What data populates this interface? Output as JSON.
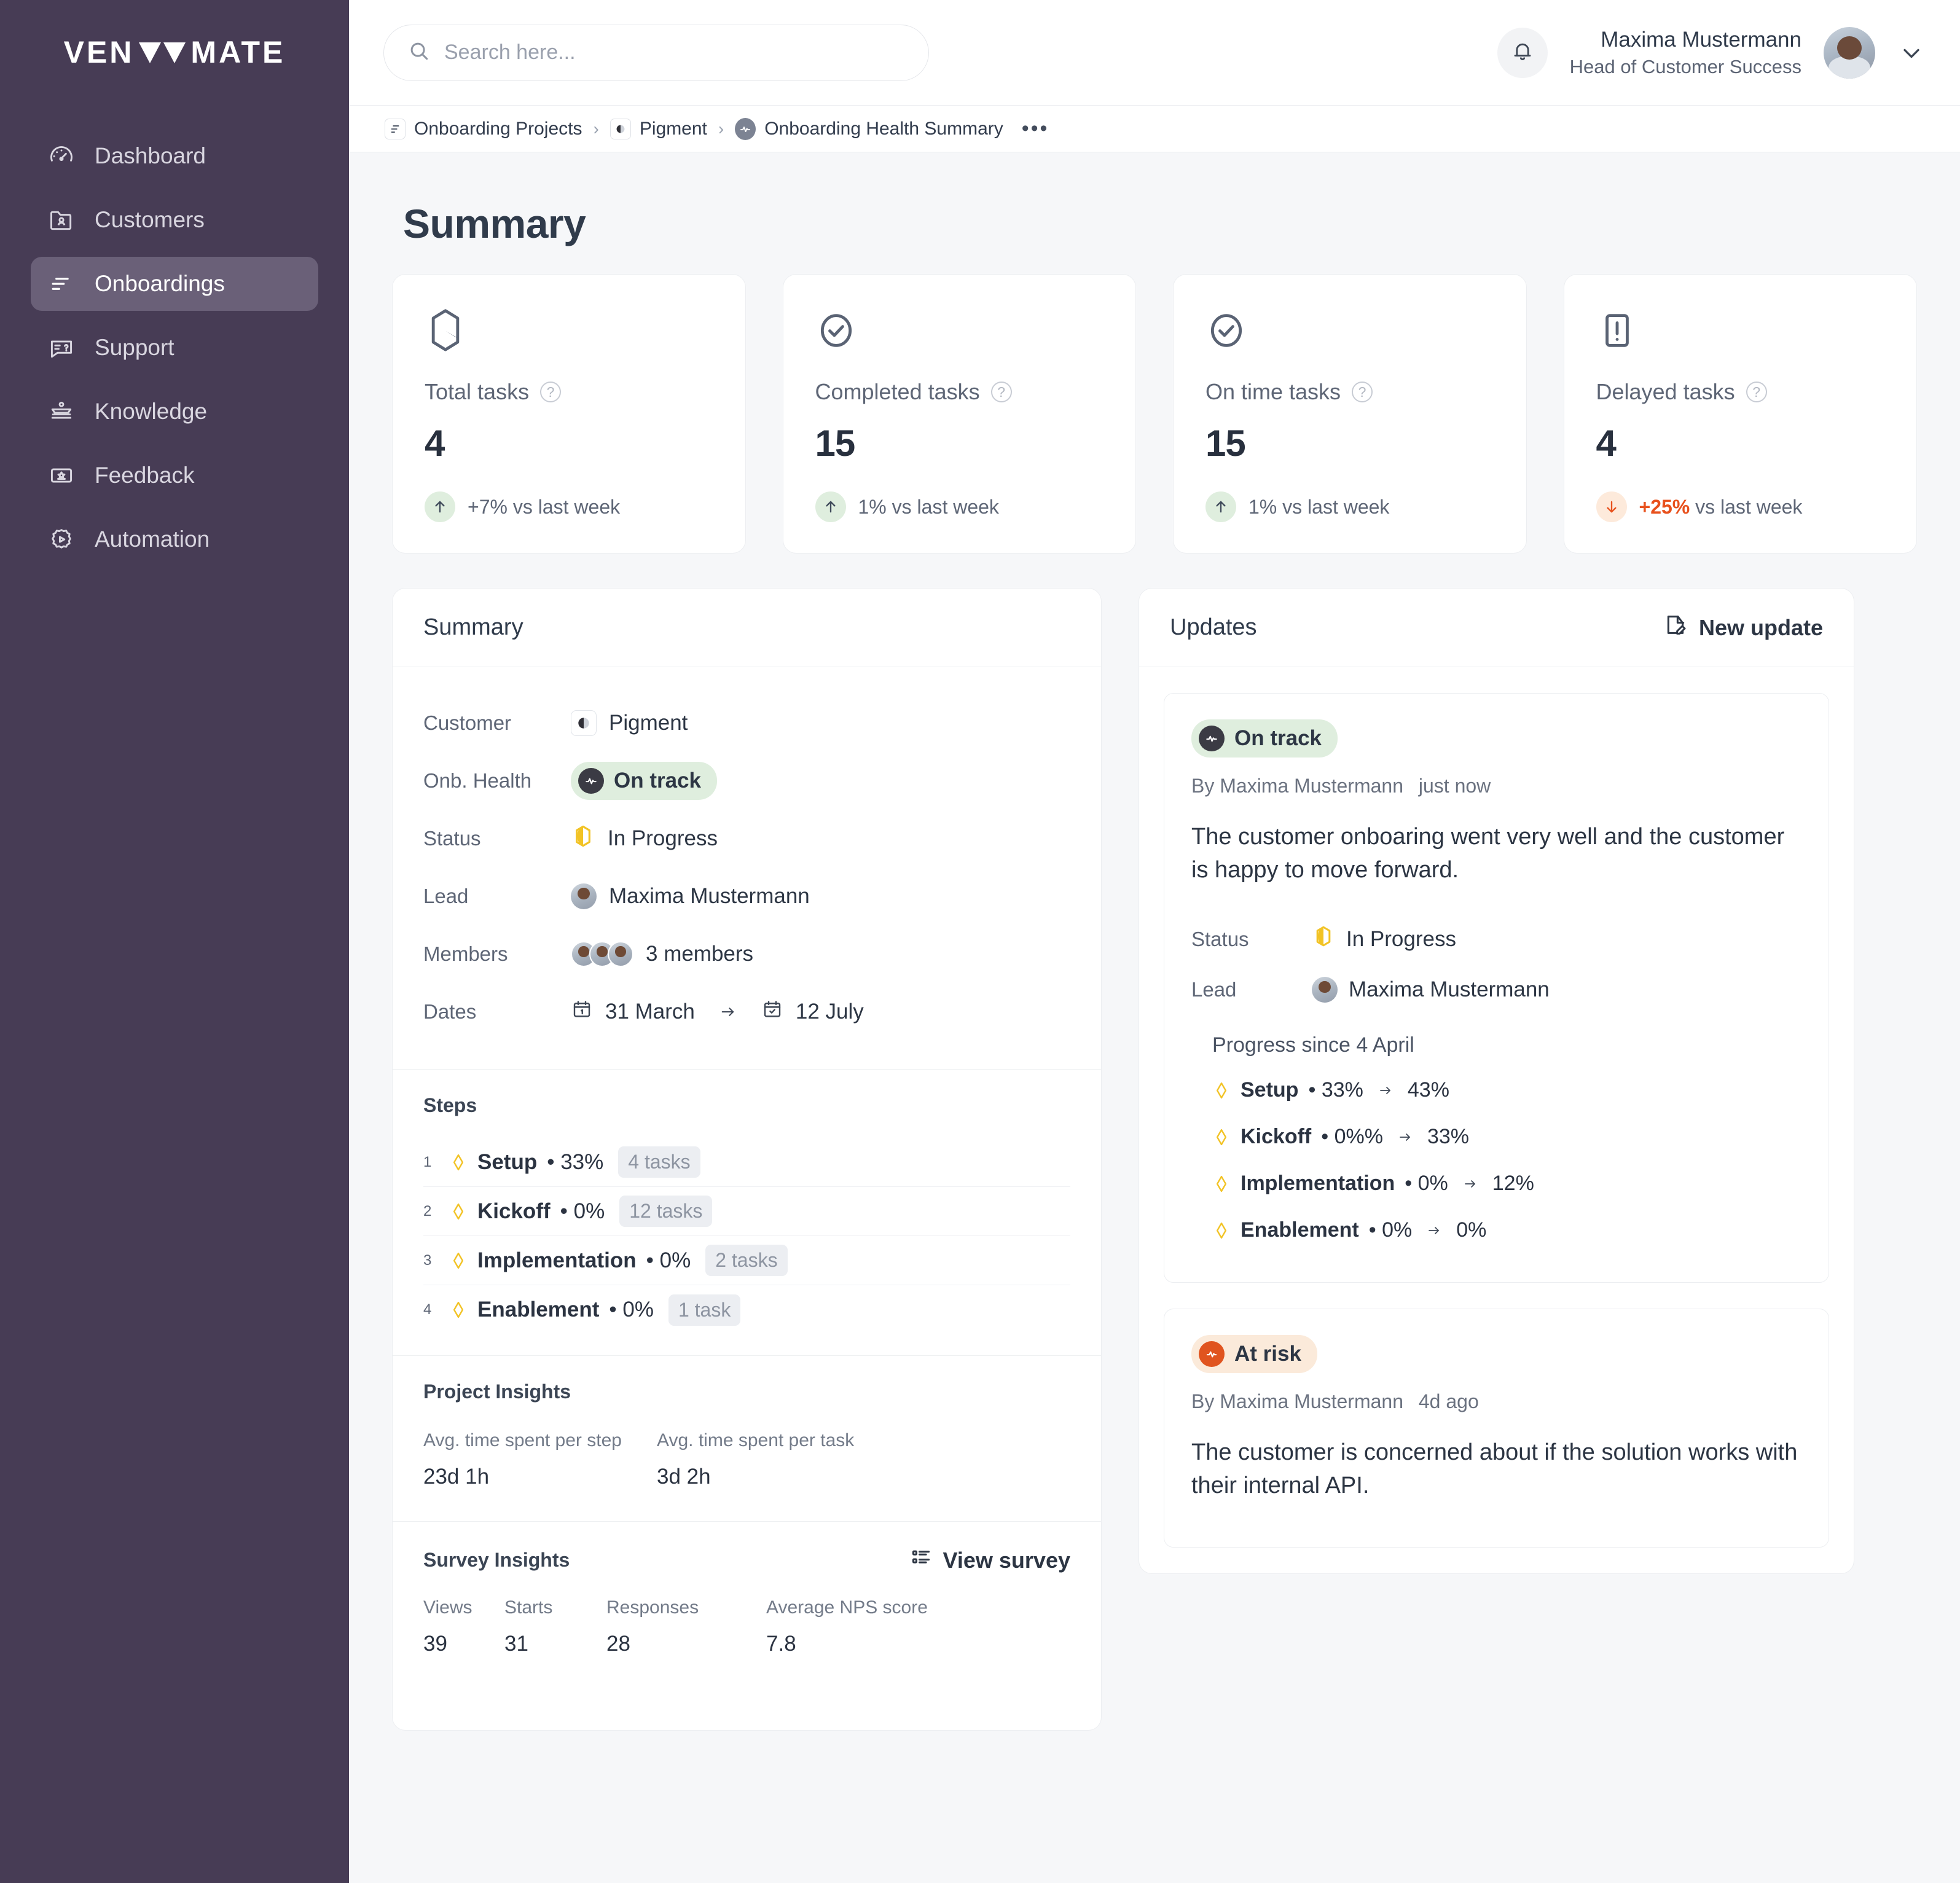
{
  "brand": {
    "name_left": "VEN",
    "name_right": "MATE",
    "sidebar_bg": "#473c55",
    "accent_green": "#dfeede",
    "accent_orange": "#e8511d"
  },
  "sidebar": {
    "items": [
      {
        "label": "Dashboard",
        "icon": "gauge-icon",
        "active": false
      },
      {
        "label": "Customers",
        "icon": "folder-user-icon",
        "active": false
      },
      {
        "label": "Onboardings",
        "icon": "onboarding-lines-icon",
        "active": true
      },
      {
        "label": "Support",
        "icon": "chat-question-icon",
        "active": false
      },
      {
        "label": "Knowledge",
        "icon": "books-icon",
        "active": false
      },
      {
        "label": "Feedback",
        "icon": "feedback-box-icon",
        "active": false
      },
      {
        "label": "Automation",
        "icon": "gear-play-icon",
        "active": false
      }
    ]
  },
  "topbar": {
    "search_placeholder": "Search here...",
    "user_name": "Maxima Mustermann",
    "user_role": "Head of Customer Success"
  },
  "breadcrumb": {
    "items": [
      {
        "label": "Onboarding Projects",
        "icon": "list-lines-icon"
      },
      {
        "label": "Pigment",
        "icon": "pigment-logo-icon"
      },
      {
        "label": "Onboarding Health Summary",
        "icon": "health-pulse-icon"
      }
    ],
    "overflow": "•••"
  },
  "page": {
    "title": "Summary"
  },
  "stats": [
    {
      "icon": "hexagon-half-icon",
      "label": "Total tasks",
      "value": "4",
      "delta": "+7%",
      "delta_suffix": "vs last week",
      "direction": "up",
      "highlight": false
    },
    {
      "icon": "check-circle-icon",
      "label": "Completed tasks",
      "value": "15",
      "delta": "1%",
      "delta_suffix": "vs last week",
      "direction": "up",
      "highlight": false
    },
    {
      "icon": "check-circle-icon",
      "label": "On time tasks",
      "value": "15",
      "delta": "1%",
      "delta_suffix": "vs last week",
      "direction": "up",
      "highlight": false
    },
    {
      "icon": "exclamation-box-icon",
      "label": "Delayed tasks",
      "value": "4",
      "delta": "+25%",
      "delta_suffix": "vs last week",
      "direction": "down",
      "highlight": true
    }
  ],
  "summary_panel": {
    "title": "Summary",
    "fields": [
      {
        "key": "Customer",
        "value": "Pigment",
        "kind": "logo"
      },
      {
        "key": "Onb. Health",
        "value": "On track",
        "kind": "badge-green"
      },
      {
        "key": "Status",
        "value": "In Progress",
        "kind": "status-diamond"
      },
      {
        "key": "Lead",
        "value": "Maxima Mustermann",
        "kind": "avatar"
      },
      {
        "key": "Members",
        "value": "3 members",
        "kind": "avatar-stack"
      },
      {
        "key": "Dates",
        "value": "",
        "kind": "dates",
        "date_start": "31 March",
        "date_end": "12 July"
      }
    ],
    "steps_title": "Steps",
    "steps": [
      {
        "num": "1",
        "name": "Setup",
        "pct": "33%",
        "tasks": "4 tasks"
      },
      {
        "num": "2",
        "name": "Kickoff",
        "pct": "0%",
        "tasks": "12 tasks"
      },
      {
        "num": "3",
        "name": "Implementation",
        "pct": "0%",
        "tasks": "2 tasks"
      },
      {
        "num": "4",
        "name": "Enablement",
        "pct": "0%",
        "tasks": "1 task"
      }
    ],
    "project_insights_title": "Project Insights",
    "project_insights": [
      {
        "label": "Avg. time spent per step",
        "value": "23d 1h"
      },
      {
        "label": "Avg. time spent per task",
        "value": "3d 2h"
      }
    ],
    "survey_title": "Survey Insights",
    "survey_action": "View survey",
    "survey_metrics": [
      {
        "label": "Views",
        "value": "39"
      },
      {
        "label": "Starts",
        "value": "31"
      },
      {
        "label": "Responses",
        "value": "28"
      },
      {
        "label": "Average NPS score",
        "value": "7.8"
      }
    ]
  },
  "updates_panel": {
    "title": "Updates",
    "action": "New update",
    "cards": [
      {
        "badge": "On track",
        "badge_kind": "green",
        "author": "By Maxima Mustermann",
        "when": "just now",
        "text": "The customer onboaring went very well and the customer is happy to move forward.",
        "fields": [
          {
            "key": "Status",
            "value": "In Progress",
            "kind": "status-diamond"
          },
          {
            "key": "Lead",
            "value": "Maxima Mustermann",
            "kind": "avatar"
          }
        ],
        "progress_title": "Progress since 4 April",
        "progress": [
          {
            "name": "Setup",
            "from": "33%",
            "to": "43%"
          },
          {
            "name": "Kickoff",
            "from": "0%%",
            "to": "33%"
          },
          {
            "name": "Implementation",
            "from": "0%",
            "to": "12%"
          },
          {
            "name": "Enablement",
            "from": "0%",
            "to": "0%"
          }
        ]
      },
      {
        "badge": "At risk",
        "badge_kind": "orange",
        "author": "By Maxima Mustermann",
        "when": "4d ago",
        "text": "The customer is concerned about if the solution works with their internal API.",
        "fields": [],
        "progress_title": "",
        "progress": []
      }
    ]
  }
}
